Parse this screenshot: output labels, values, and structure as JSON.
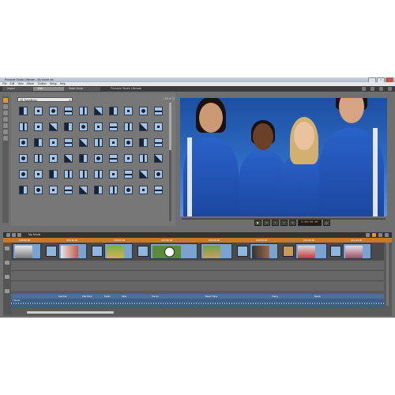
{
  "window": {
    "title": "Pinnacle Studio Ultimate - My Movie.stx"
  },
  "menu": [
    "File",
    "Edit",
    "View",
    "Album",
    "Toolbox",
    "Setup",
    "Help"
  ],
  "mode_tabs": [
    "Import",
    "Edit",
    "Make Movie"
  ],
  "app_name": "Pinnacle Studio Ultimate",
  "library": {
    "dropdown": "2D Transitions",
    "counter": "1-54 of 74"
  },
  "player": {
    "timecode": "0:00:00.00"
  },
  "timeline": {
    "project_name": "My Movie",
    "ruler_labels": [
      "0:00:00.00",
      "0:00:10.00",
      "0:00:20.00",
      "0:00:30.00",
      "0:00:40.00",
      "0:00:50.00",
      "0:01:00.00",
      "0:01:10.00"
    ],
    "audio_label": "Theme",
    "caption_labels": [
      "Carnival",
      "Kids Party",
      "Fields",
      "Slide",
      "Soccer",
      "Beach Party",
      "Swing",
      "Beach"
    ]
  },
  "colors": {
    "accent": "#e09a2c",
    "sky": "#2f6cc4",
    "jersey": "#2a62c9"
  }
}
